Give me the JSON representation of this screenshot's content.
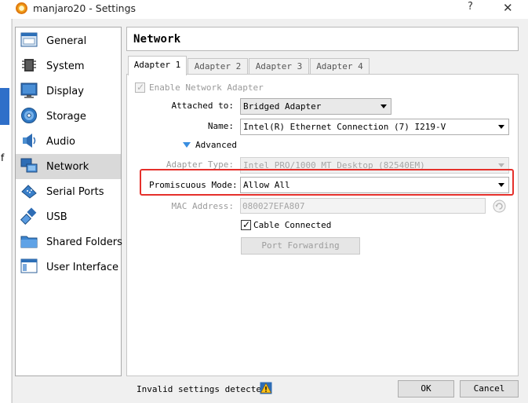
{
  "window": {
    "title": "manjaro20 - Settings",
    "help_glyph": "?",
    "close_glyph": "✕"
  },
  "background_window": {
    "visible_char": "f"
  },
  "sidebar": {
    "items": [
      {
        "label": "General",
        "icon": "general-icon"
      },
      {
        "label": "System",
        "icon": "system-chip-icon"
      },
      {
        "label": "Display",
        "icon": "display-monitor-icon"
      },
      {
        "label": "Storage",
        "icon": "storage-disk-icon"
      },
      {
        "label": "Audio",
        "icon": "audio-speaker-icon"
      },
      {
        "label": "Network",
        "icon": "network-icon",
        "selected": true
      },
      {
        "label": "Serial Ports",
        "icon": "serial-port-icon"
      },
      {
        "label": "USB",
        "icon": "usb-icon"
      },
      {
        "label": "Shared Folders",
        "icon": "folder-icon"
      },
      {
        "label": "User Interface",
        "icon": "user-interface-icon"
      }
    ]
  },
  "header": {
    "title": "Network"
  },
  "tabs": [
    {
      "label": "Adapter 1",
      "active": true
    },
    {
      "label": "Adapter 2"
    },
    {
      "label": "Adapter 3"
    },
    {
      "label": "Adapter 4"
    }
  ],
  "adapter": {
    "enable_label": "Enable Network Adapter",
    "enable_checked": true,
    "attached_to_label": "Attached to:",
    "attached_to_value": "Bridged Adapter",
    "name_label": "Name:",
    "name_value": "Intel(R) Ethernet Connection (7) I219-V",
    "advanced_label": "Advanced",
    "adapter_type_label": "Adapter Type:",
    "adapter_type_value": "Intel PRO/1000 MT Desktop (82540EM)",
    "promiscuous_label": "Promiscuous Mode:",
    "promiscuous_value": "Allow All",
    "mac_label": "MAC Address:",
    "mac_value": "080027EFA807",
    "cable_label": "Cable Connected",
    "cable_checked": true,
    "port_forwarding_label": "Port Forwarding"
  },
  "footer": {
    "status_text": "Invalid settings detected",
    "warning_icon": "warning-icon",
    "ok_label": "OK",
    "cancel_label": "Cancel"
  },
  "colors": {
    "highlight_box": "#e5302b",
    "selected_item": "#d9d9d9",
    "accent_blue": "#3a8ee0"
  }
}
